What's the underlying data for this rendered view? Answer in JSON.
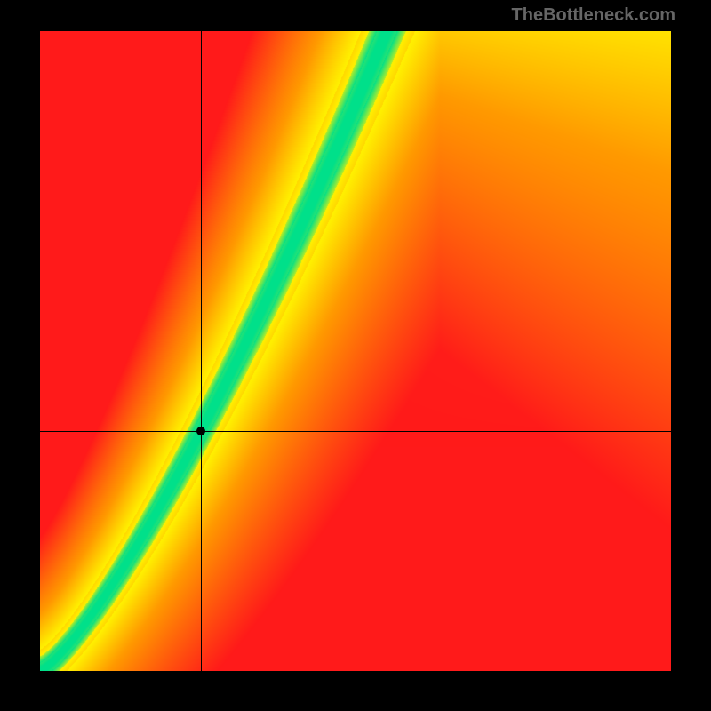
{
  "attribution": "TheBottleneck.com",
  "chart_data": {
    "type": "heatmap",
    "title": "",
    "xlabel": "",
    "ylabel": "",
    "xlim": [
      0,
      1
    ],
    "ylim": [
      0,
      1
    ],
    "marker": {
      "x": 0.255,
      "y": 0.375
    },
    "crosshair": {
      "x": 0.255,
      "y": 0.375
    },
    "optimal_curve_description": "Green ridge running from bottom-left toward upper-middle, slightly super-linear slope; away from ridge transitions yellow then orange then red.",
    "color_stops": {
      "optimal": "#00e08a",
      "near": "#fff200",
      "mid": "#ff9a00",
      "far": "#ff1a1a"
    }
  }
}
